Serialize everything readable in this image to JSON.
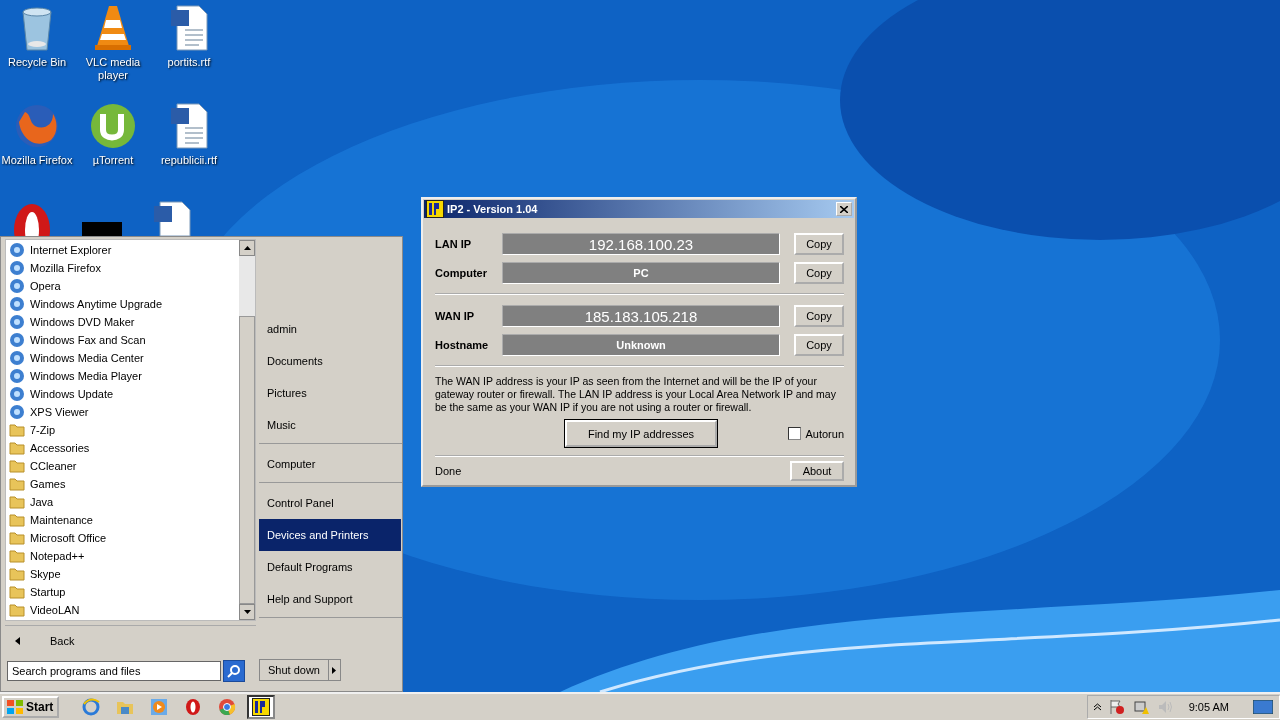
{
  "desktop_icons": [
    {
      "label": "Recycle Bin",
      "kind": "bin"
    },
    {
      "label": "VLC media player",
      "kind": "cone"
    },
    {
      "label": "portits.rtf",
      "kind": "doc"
    },
    {
      "label": "Mozilla Firefox",
      "kind": "firefox"
    },
    {
      "label": "µTorrent",
      "kind": "torrent"
    },
    {
      "label": "republicii.rtf",
      "kind": "doc"
    }
  ],
  "start_menu": {
    "programs": [
      {
        "label": "Internet Explorer",
        "kind": "app"
      },
      {
        "label": "Mozilla Firefox",
        "kind": "app"
      },
      {
        "label": "Opera",
        "kind": "app"
      },
      {
        "label": "Windows Anytime Upgrade",
        "kind": "app"
      },
      {
        "label": "Windows DVD Maker",
        "kind": "app"
      },
      {
        "label": "Windows Fax and Scan",
        "kind": "app"
      },
      {
        "label": "Windows Media Center",
        "kind": "app"
      },
      {
        "label": "Windows Media Player",
        "kind": "app"
      },
      {
        "label": "Windows Update",
        "kind": "app"
      },
      {
        "label": "XPS Viewer",
        "kind": "app"
      },
      {
        "label": "7-Zip",
        "kind": "folder"
      },
      {
        "label": "Accessories",
        "kind": "folder"
      },
      {
        "label": "CCleaner",
        "kind": "folder"
      },
      {
        "label": "Games",
        "kind": "folder"
      },
      {
        "label": "Java",
        "kind": "folder"
      },
      {
        "label": "Maintenance",
        "kind": "folder"
      },
      {
        "label": "Microsoft Office",
        "kind": "folder"
      },
      {
        "label": "Notepad++",
        "kind": "folder"
      },
      {
        "label": "Skype",
        "kind": "folder"
      },
      {
        "label": "Startup",
        "kind": "folder"
      },
      {
        "label": "VideoLAN",
        "kind": "folder"
      }
    ],
    "back": "Back",
    "search": {
      "placeholder": "Search programs and files"
    },
    "right_groups": [
      [
        {
          "label": "admin",
          "selected": false
        },
        {
          "label": "Documents",
          "selected": false
        },
        {
          "label": "Pictures",
          "selected": false
        },
        {
          "label": "Music",
          "selected": false
        }
      ],
      [
        {
          "label": "Computer",
          "selected": false
        }
      ],
      [
        {
          "label": "Control Panel",
          "selected": false
        },
        {
          "label": "Devices and Printers",
          "selected": true
        },
        {
          "label": "Default Programs",
          "selected": false
        },
        {
          "label": "Help and Support",
          "selected": false
        }
      ]
    ],
    "shut_down": "Shut down"
  },
  "ip2_window": {
    "title": "IP2 - Version 1.04",
    "groups": [
      [
        {
          "label": "LAN IP",
          "value": "192.168.100.23",
          "kind": "address",
          "button": "Copy"
        },
        {
          "label": "Computer",
          "value": "PC",
          "kind": "name",
          "button": "Copy"
        }
      ],
      [
        {
          "label": "WAN IP",
          "value": "185.183.105.218",
          "kind": "address",
          "button": "Copy"
        },
        {
          "label": "Hostname",
          "value": "Unknown",
          "kind": "name",
          "button": "Copy"
        }
      ]
    ],
    "description": "The WAN IP address is your IP as seen from the Internet and will be the IP of your gateway router or firewall. The LAN IP address is your Local Area Network IP and may be the same as your WAN IP if you are not using a router or firewall.",
    "find_button": "Find my IP addresses",
    "autorun": {
      "label": "Autorun",
      "checked": false
    },
    "status": "Done",
    "about_button": "About"
  },
  "taskbar": {
    "start": "Start",
    "items": [
      {
        "kind": "ie",
        "selected": false
      },
      {
        "kind": "explorer",
        "selected": false
      },
      {
        "kind": "media",
        "selected": false
      },
      {
        "kind": "opera",
        "selected": false
      },
      {
        "kind": "chrome",
        "selected": false
      },
      {
        "kind": "ip2",
        "selected": true
      }
    ],
    "clock": "9:05 AM"
  }
}
